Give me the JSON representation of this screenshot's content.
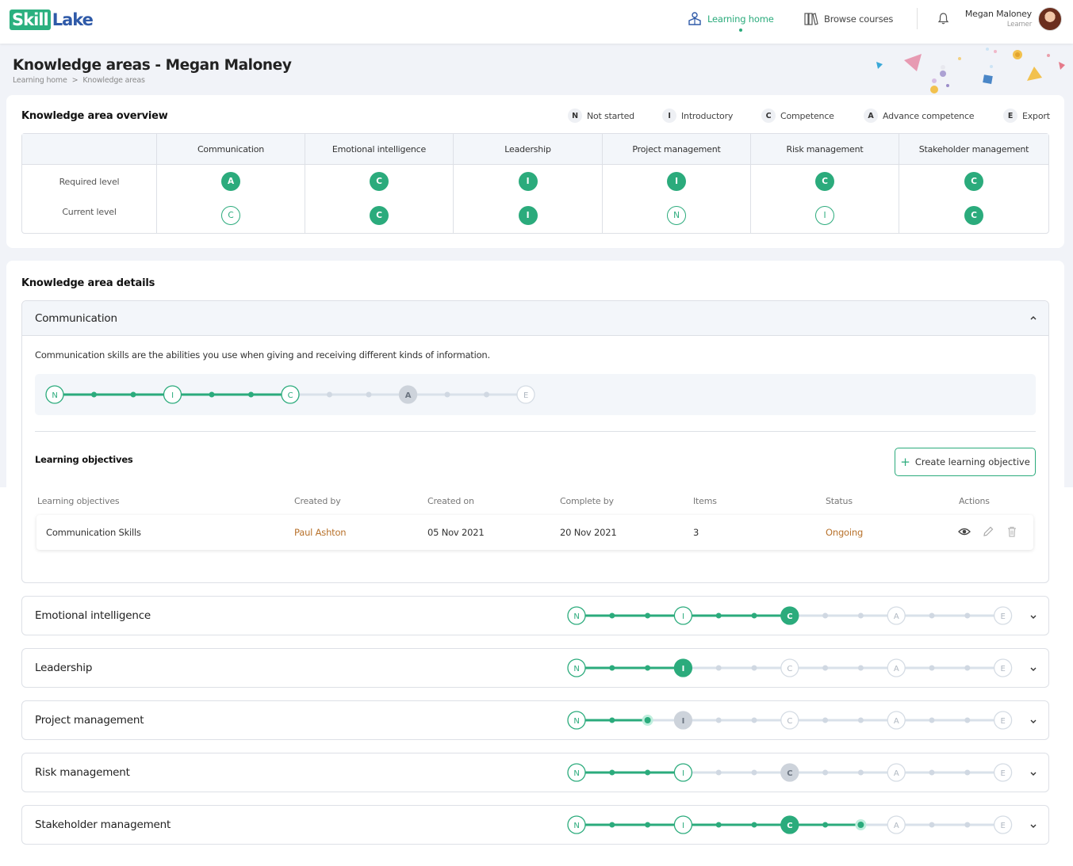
{
  "header": {
    "logo_part1": "Skill",
    "logo_part2": "Lake",
    "nav_home": "Learning home",
    "nav_browse": "Browse courses",
    "user_name": "Megan Maloney",
    "user_role": "Learner"
  },
  "page": {
    "title": "Knowledge areas - Megan Maloney",
    "breadcrumb": [
      "Learning home",
      ">",
      "Knowledge areas"
    ]
  },
  "overview": {
    "title": "Knowledge area overview",
    "legend": [
      {
        "letter": "N",
        "label": "Not started"
      },
      {
        "letter": "I",
        "label": "Introductory"
      },
      {
        "letter": "C",
        "label": "Competence"
      },
      {
        "letter": "A",
        "label": "Advance competence"
      },
      {
        "letter": "E",
        "label": "Export"
      }
    ],
    "row_labels": [
      "Required level",
      "Current level"
    ],
    "columns": [
      {
        "name": "Communication",
        "required": "A",
        "current": "C",
        "current_style": "outline"
      },
      {
        "name": "Emotional intelligence",
        "required": "C",
        "current": "C",
        "current_style": "filled"
      },
      {
        "name": "Leadership",
        "required": "I",
        "current": "I",
        "current_style": "filled"
      },
      {
        "name": "Project management",
        "required": "I",
        "current": "N",
        "current_style": "outline"
      },
      {
        "name": "Risk management",
        "required": "C",
        "current": "I",
        "current_style": "outline"
      },
      {
        "name": "Stakeholder management",
        "required": "C",
        "current": "C",
        "current_style": "filled"
      }
    ]
  },
  "details": {
    "title": "Knowledge area details",
    "open_area": {
      "name": "Communication",
      "description": "Communication skills are the abilities you use when giving and receiving different kinds of information.",
      "progress": {
        "levels": [
          "N",
          "I",
          "C",
          "A",
          "E"
        ],
        "achieved_level": "C",
        "target_level": "A"
      },
      "objectives_title": "Learning objectives",
      "create_button": "Create learning objective",
      "table": {
        "headers": [
          "Learning objectives",
          "Created by",
          "Created on",
          "Complete by",
          "Items",
          "Status",
          "Actions"
        ],
        "rows": [
          {
            "objective": "Communication Skills",
            "created_by": "Paul Ashton",
            "created_on": "05 Nov 2021",
            "complete_by": "20 Nov 2021",
            "items": "3",
            "status": "Ongoing"
          }
        ]
      }
    },
    "closed_areas": [
      {
        "name": "Emotional intelligence",
        "achieved_level": "C",
        "target_level": "C",
        "extra_dot": null
      },
      {
        "name": "Leadership",
        "achieved_level": "I",
        "target_level": "I",
        "extra_dot": null
      },
      {
        "name": "Project management",
        "achieved_level": "N",
        "target_level": "I",
        "extra_dot": "N+2"
      },
      {
        "name": "Risk management",
        "achieved_level": "I",
        "target_level": "C",
        "extra_dot": null
      },
      {
        "name": "Stakeholder management",
        "achieved_level": "C",
        "target_level": "C",
        "extra_dot": "C+2"
      }
    ]
  },
  "colors": {
    "accent": "#2bab7c",
    "status_ongoing": "#b8722c",
    "track_gray": "#d9e1ea",
    "logo_blue": "#2f5aa8"
  }
}
